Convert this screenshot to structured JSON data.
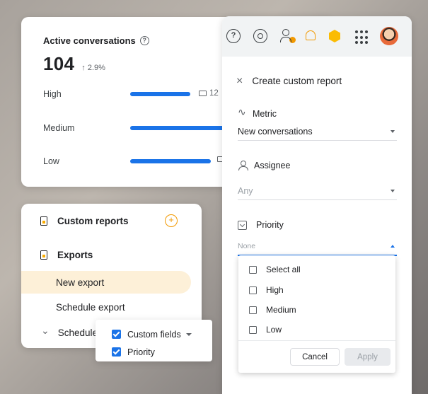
{
  "stats": {
    "title": "Active conversations",
    "help_glyph": "?",
    "value": "104",
    "trend": "2.9%",
    "trend_arrow": "↑",
    "rows": [
      {
        "label": "High",
        "count": "12",
        "fill": 0.55
      },
      {
        "label": "Medium",
        "count": "",
        "fill": 1.0
      },
      {
        "label": "Low",
        "count": "",
        "fill": 0.74
      }
    ]
  },
  "reports": {
    "custom_reports": "Custom reports",
    "add_glyph": "+",
    "exports": "Exports",
    "new_export": "New export",
    "schedule_export": "Schedule export",
    "scheduled_partial": "Schedule",
    "chevron_glyph": "⌄"
  },
  "fields_popup": {
    "custom_fields": "Custom fields",
    "priority": "Priority"
  },
  "panel": {
    "help_glyph": "?",
    "title": "Create custom report",
    "close_glyph": "×",
    "metric_label": "Metric",
    "metric_value": "New conversations",
    "assignee_label": "Assignee",
    "assignee_placeholder": "Any",
    "priority_label": "Priority",
    "priority_placeholder": "None"
  },
  "priority_dropdown": {
    "options": [
      "Select all",
      "High",
      "Medium",
      "Low"
    ],
    "cancel": "Cancel",
    "apply": "Apply"
  },
  "colors": {
    "accent_blue": "#1a73e8",
    "accent_orange": "#f29900",
    "highlight": "#fdf0d8"
  }
}
